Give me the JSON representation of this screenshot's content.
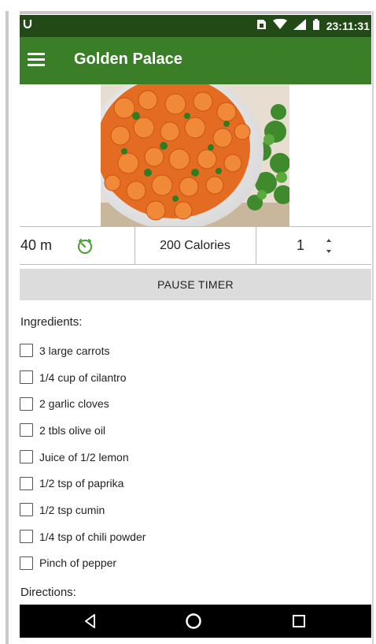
{
  "status_bar": {
    "time": "23:11:31",
    "icons": [
      "notification-icon",
      "sim-icon",
      "wifi-icon",
      "signal-icon",
      "battery-icon"
    ]
  },
  "app_bar": {
    "menu_icon": "hamburger-menu-icon",
    "title": "Golden Palace",
    "color": "#3a7f28"
  },
  "recipe": {
    "image": "carrot-salad-photo",
    "time": "40 m",
    "timer_icon": "timer-icon",
    "calories": "200 Calories",
    "servings": "1",
    "stepper_icon": "up-down-stepper-icon"
  },
  "actions": {
    "pause_timer": "PAUSE TIMER"
  },
  "ingredients": {
    "title": "Ingredients:",
    "items": [
      "3 large carrots",
      "1/4 cup of cilantro",
      "2 garlic cloves",
      "2 tbls olive oil",
      "Juice of 1/2 lemon",
      "1/2 tsp of paprika",
      "1/2 tsp cumin",
      "1/4 tsp of chili powder",
      "Pinch of pepper"
    ]
  },
  "directions": {
    "title": "Directions:"
  },
  "nav_bar": {
    "icons": [
      "back-icon",
      "home-icon",
      "recent-apps-icon"
    ]
  }
}
